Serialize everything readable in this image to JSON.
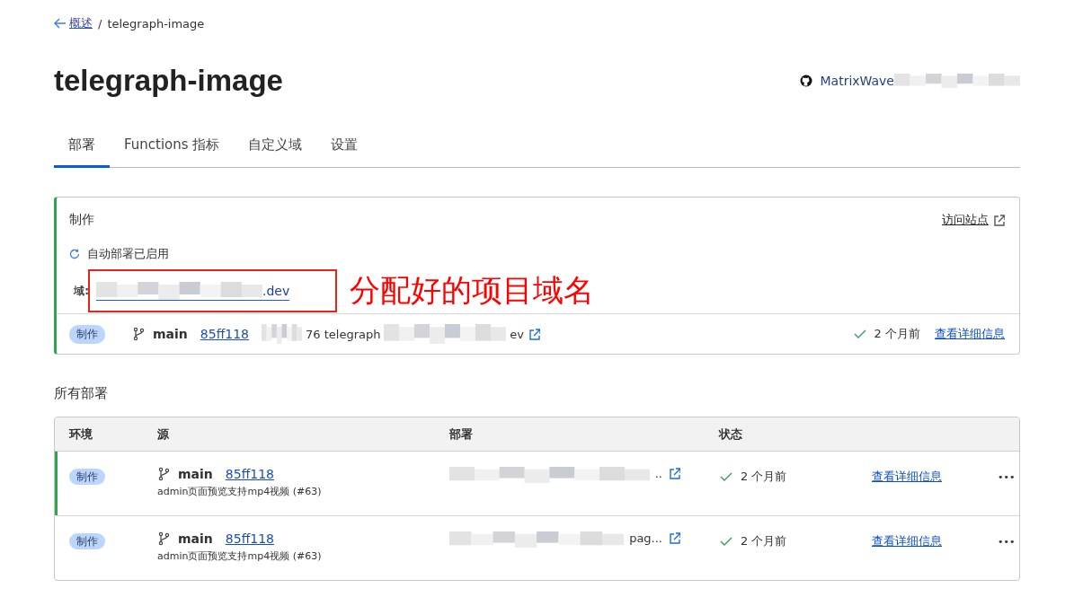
{
  "breadcrumb": {
    "back_link": "概述",
    "separator": "/",
    "current": "telegraph-image"
  },
  "title": "telegraph-image",
  "owner": {
    "segments": [
      {
        "kind": "text",
        "text": "MatrixWave"
      },
      {
        "kind": "redacted"
      }
    ]
  },
  "tabs": [
    {
      "label": "部署",
      "selected": true
    },
    {
      "label": "Functions 指标",
      "selected": false
    },
    {
      "label": "自定义域",
      "selected": false
    },
    {
      "label": "设置",
      "selected": false
    }
  ],
  "production": {
    "heading": "制作",
    "visit_link": "访问站点",
    "auto_deploy": "自动部署已启用",
    "domain_label": "域:",
    "domain": [
      {
        "kind": "redacted"
      },
      {
        "kind": "text",
        "text": ".dev"
      }
    ],
    "annotation": "分配好的项目域名",
    "latest": {
      "env": "制作",
      "branch": "main",
      "commit": "85ff118",
      "url": [
        {
          "kind": "redacted"
        },
        {
          "kind": "text",
          "text": "76 telegraph"
        },
        {
          "kind": "redacted"
        },
        {
          "kind": "text",
          "text": "ev"
        }
      ],
      "status": "2 个月前",
      "details_link": "查看详细信息"
    }
  },
  "all_deployments": {
    "heading": "所有部署",
    "columns": [
      "环境",
      "源",
      "部署",
      "状态"
    ],
    "rows": [
      {
        "env": "制作",
        "active": true,
        "branch": "main",
        "commit": "85ff118",
        "message": "admin页面预览支持mp4视频 (#63)",
        "url": [
          {
            "kind": "redacted"
          },
          {
            "kind": "text",
            "text": ".."
          }
        ],
        "status": "2 个月前",
        "details_link": "查看详细信息",
        "more": "•••"
      },
      {
        "env": "制作",
        "active": false,
        "branch": "main",
        "commit": "85ff118",
        "message": "admin页面预览支持mp4视频 (#63)",
        "url": [
          {
            "kind": "redacted"
          },
          {
            "kind": "text",
            "text": "pag..."
          }
        ],
        "status": "2 个月前",
        "details_link": "查看详细信息",
        "more": "•••"
      }
    ]
  }
}
